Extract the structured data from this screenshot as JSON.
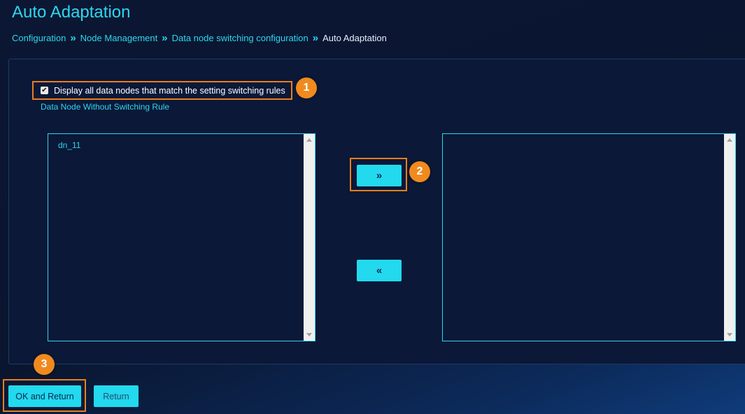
{
  "page": {
    "title": "Auto Adaptation"
  },
  "breadcrumb": {
    "items": [
      "Configuration",
      "Node Management",
      "Data node switching configuration"
    ],
    "separator": "»",
    "current": "Auto Adaptation"
  },
  "filter": {
    "checkbox_label": "Display all data nodes that match the setting switching rules",
    "checked": true,
    "check_mark": "✔"
  },
  "source_list": {
    "label": "Data Node Without Switching Rule",
    "items": [
      "dn_11"
    ]
  },
  "target_list": {
    "items": []
  },
  "move_buttons": {
    "move_right": "»",
    "move_left": "«"
  },
  "footer": {
    "ok_label": "OK and Return",
    "return_label": "Return"
  },
  "annotations": [
    "1",
    "2",
    "3"
  ],
  "colors": {
    "accent": "#22d9ee",
    "highlight": "#e87f1c",
    "badge": "#f08a1e",
    "background": "#0b1733"
  }
}
